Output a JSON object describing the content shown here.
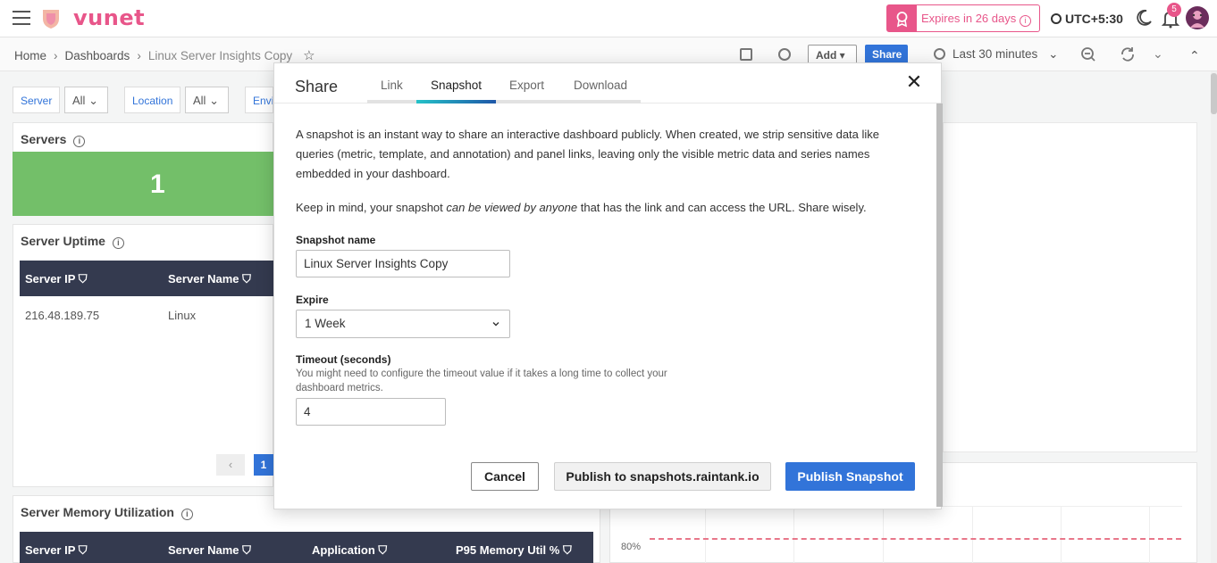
{
  "topbar": {
    "brand": "vunet",
    "expire_text": "Expires in 26 days",
    "timezone": "UTC+5:30",
    "notification_count": "5"
  },
  "breadcrumb": {
    "home": "Home",
    "dashboards": "Dashboards",
    "current": "Linux Server Insights Copy"
  },
  "toolbar": {
    "add_label": "Add",
    "share_label": "Share",
    "time_range": "Last 30 minutes"
  },
  "variables": [
    {
      "label": "Server",
      "value": "All"
    },
    {
      "label": "Location",
      "value": "All"
    },
    {
      "label": "Envi",
      "value": ""
    }
  ],
  "panels": {
    "servers": {
      "title": "Servers",
      "value": "1"
    },
    "uptime": {
      "title": "Server Uptime",
      "columns": [
        "Server IP",
        "Server Name"
      ],
      "rows": [
        [
          "216.48.189.75",
          "Linux"
        ]
      ],
      "page": "1"
    },
    "memory": {
      "title": "Server Memory Utilization",
      "columns": [
        "Server IP",
        "Server Name",
        "Application",
        "P95 Memory Util %"
      ]
    },
    "chart": {
      "y_tick": "80%"
    }
  },
  "modal": {
    "title": "Share",
    "tabs": [
      "Link",
      "Snapshot",
      "Export",
      "Download"
    ],
    "active_tab": "Snapshot",
    "description_1": "A snapshot is an instant way to share an interactive dashboard publicly. When created, we strip sensitive data like queries (metric, template, and annotation) and panel links, leaving only the visible metric data and series names embedded in your dashboard.",
    "description_2_pre": "Keep in mind, your snapshot ",
    "description_2_em": "can be viewed by anyone",
    "description_2_post": " that has the link and can access the URL. Share wisely.",
    "snapshot_name_label": "Snapshot name",
    "snapshot_name_value": "Linux Server Insights Copy",
    "expire_label": "Expire",
    "expire_value": "1 Week",
    "timeout_label": "Timeout (seconds)",
    "timeout_hint": "You might need to configure the timeout value if it takes a long time to collect your dashboard metrics.",
    "timeout_value": "4",
    "cancel_label": "Cancel",
    "publish_external_label": "Publish to snapshots.raintank.io",
    "publish_label": "Publish Snapshot"
  },
  "colors": {
    "brand": "#e8568a",
    "primary": "#3274d9",
    "stat_green": "#73bf69",
    "table_header": "#343a4f"
  }
}
